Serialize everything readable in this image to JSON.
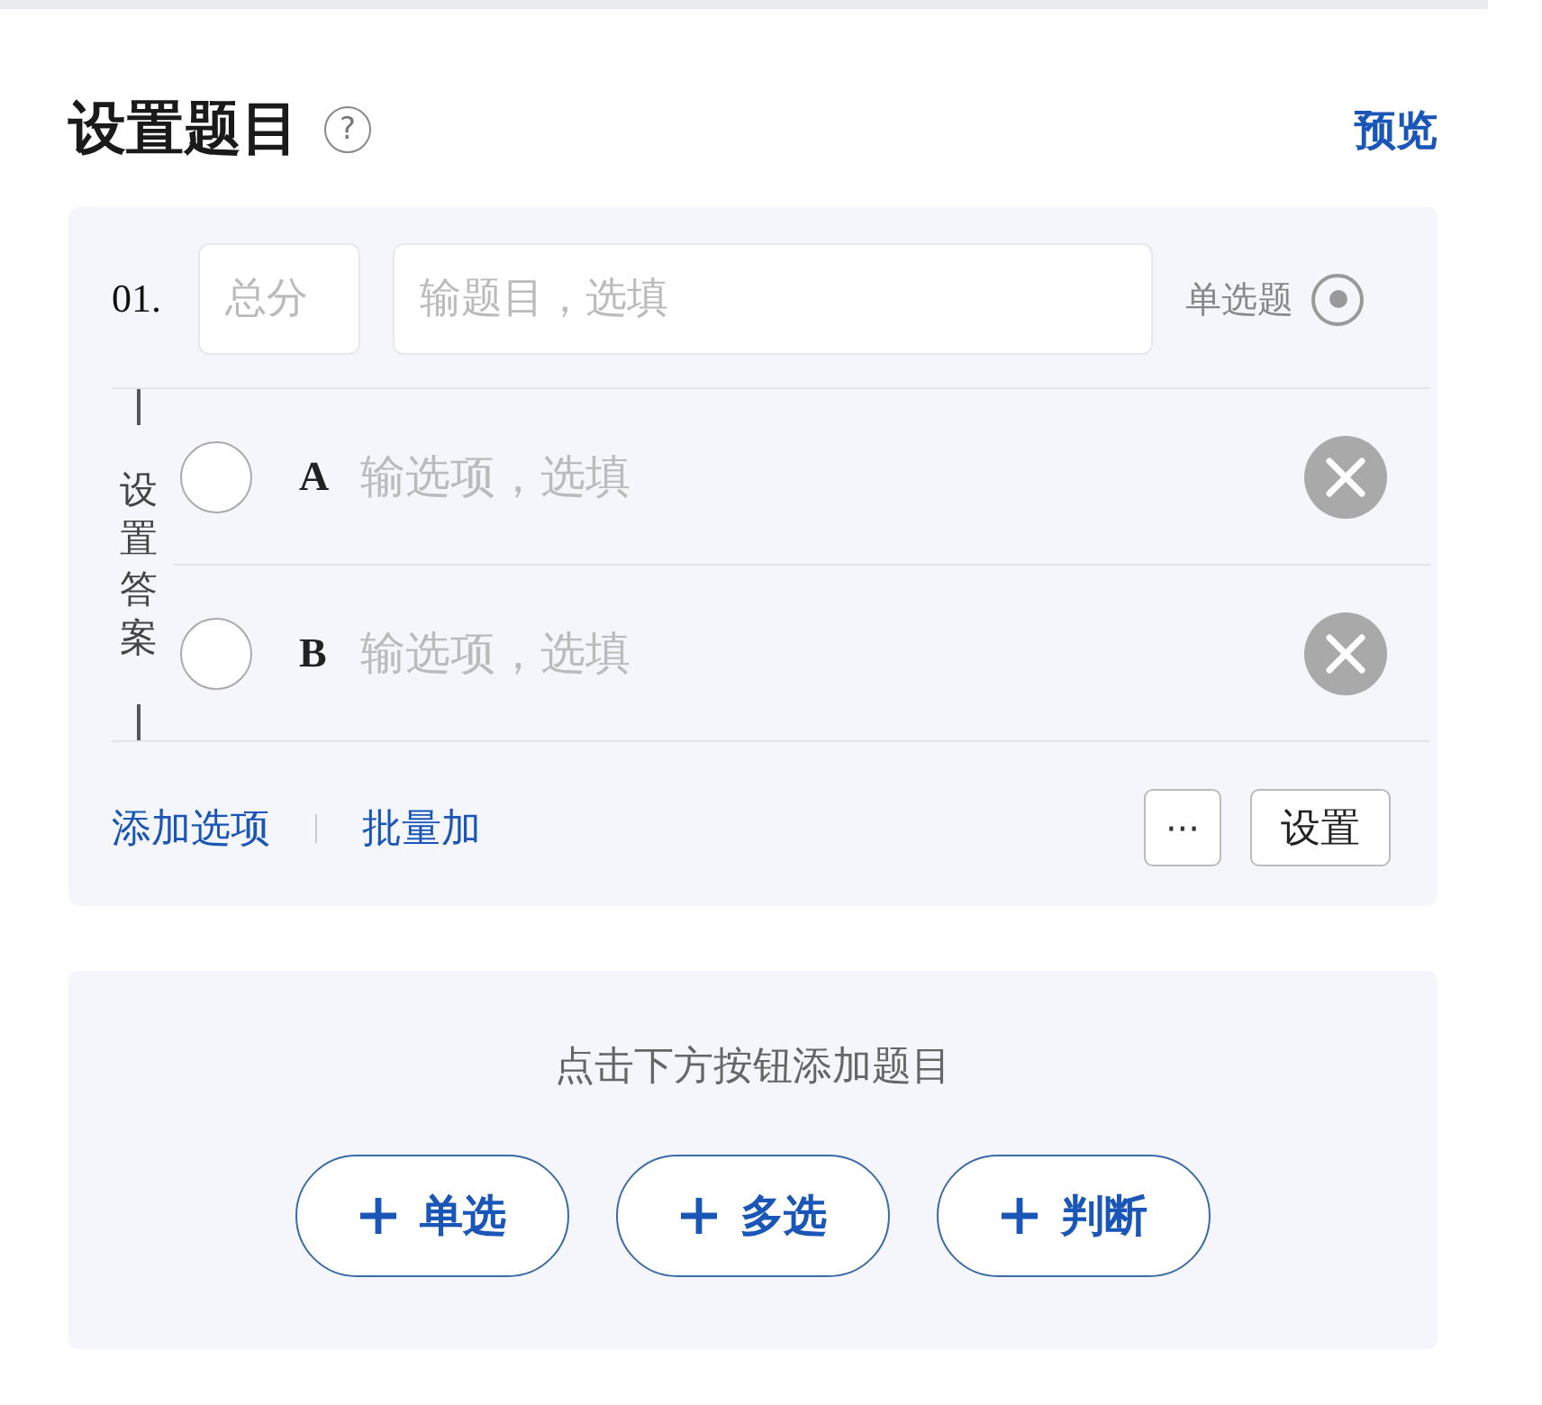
{
  "header": {
    "title": "设置题目",
    "help": "?",
    "preview": "预览"
  },
  "question": {
    "number": "01.",
    "score_placeholder": "总分",
    "title_placeholder": "输题目，选填",
    "type_label": "单选题",
    "type_selected": true,
    "answer_label": "设置答案",
    "options": [
      {
        "letter": "A",
        "placeholder": "输选项，选填",
        "checked": false
      },
      {
        "letter": "B",
        "placeholder": "输选项，选填",
        "checked": false
      }
    ],
    "links": [
      "添加选项",
      "批量加"
    ],
    "more": "···",
    "settings": "设置"
  },
  "add_panel": {
    "hint": "点击下方按钮添加题目",
    "buttons": [
      {
        "label": "单选"
      },
      {
        "label": "多选"
      },
      {
        "label": "判断"
      }
    ]
  }
}
